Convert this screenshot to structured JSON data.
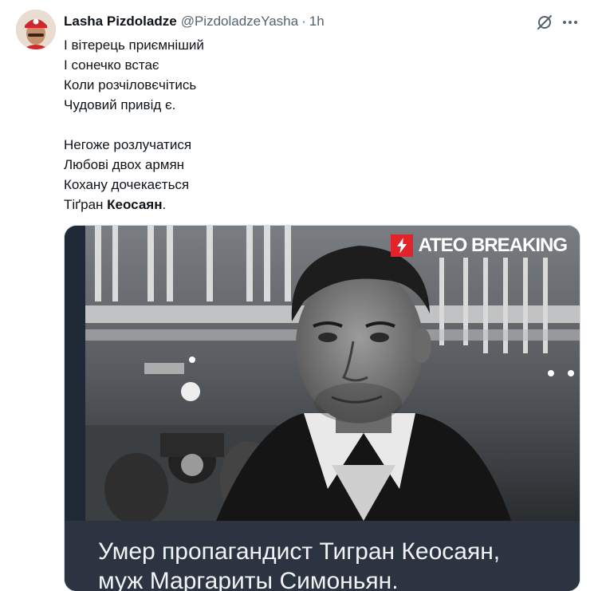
{
  "author": {
    "display_name": "Lasha Pizdoladze",
    "handle": "@PizdoladzeYasha",
    "separator": "·",
    "time": "1h",
    "avatar_icon": "avatar-mario-costume"
  },
  "actions": {
    "grok_icon": "grok-icon",
    "more_icon": "more-dots-icon"
  },
  "tweet": {
    "stanza1": [
      "І вітерець приємніший",
      "І сонечко встає",
      "Коли розчіловєчітись",
      "Чудовий привід є."
    ],
    "stanza2_lines": [
      "Негоже розлучатися",
      "Любові двох армян",
      "Кохану дочекається"
    ],
    "last_line_prefix": "Тіґран ",
    "last_line_bold": "Кеосаян",
    "last_line_suffix": "."
  },
  "media": {
    "brand_text": "ATEO BREAKING",
    "brand_icon": "lightning-icon",
    "brand_color": "#e2232a",
    "caption_line1": "Умер пропагандист Тигран Кеосаян,",
    "caption_line2": "муж Маргариты Симоньян."
  }
}
